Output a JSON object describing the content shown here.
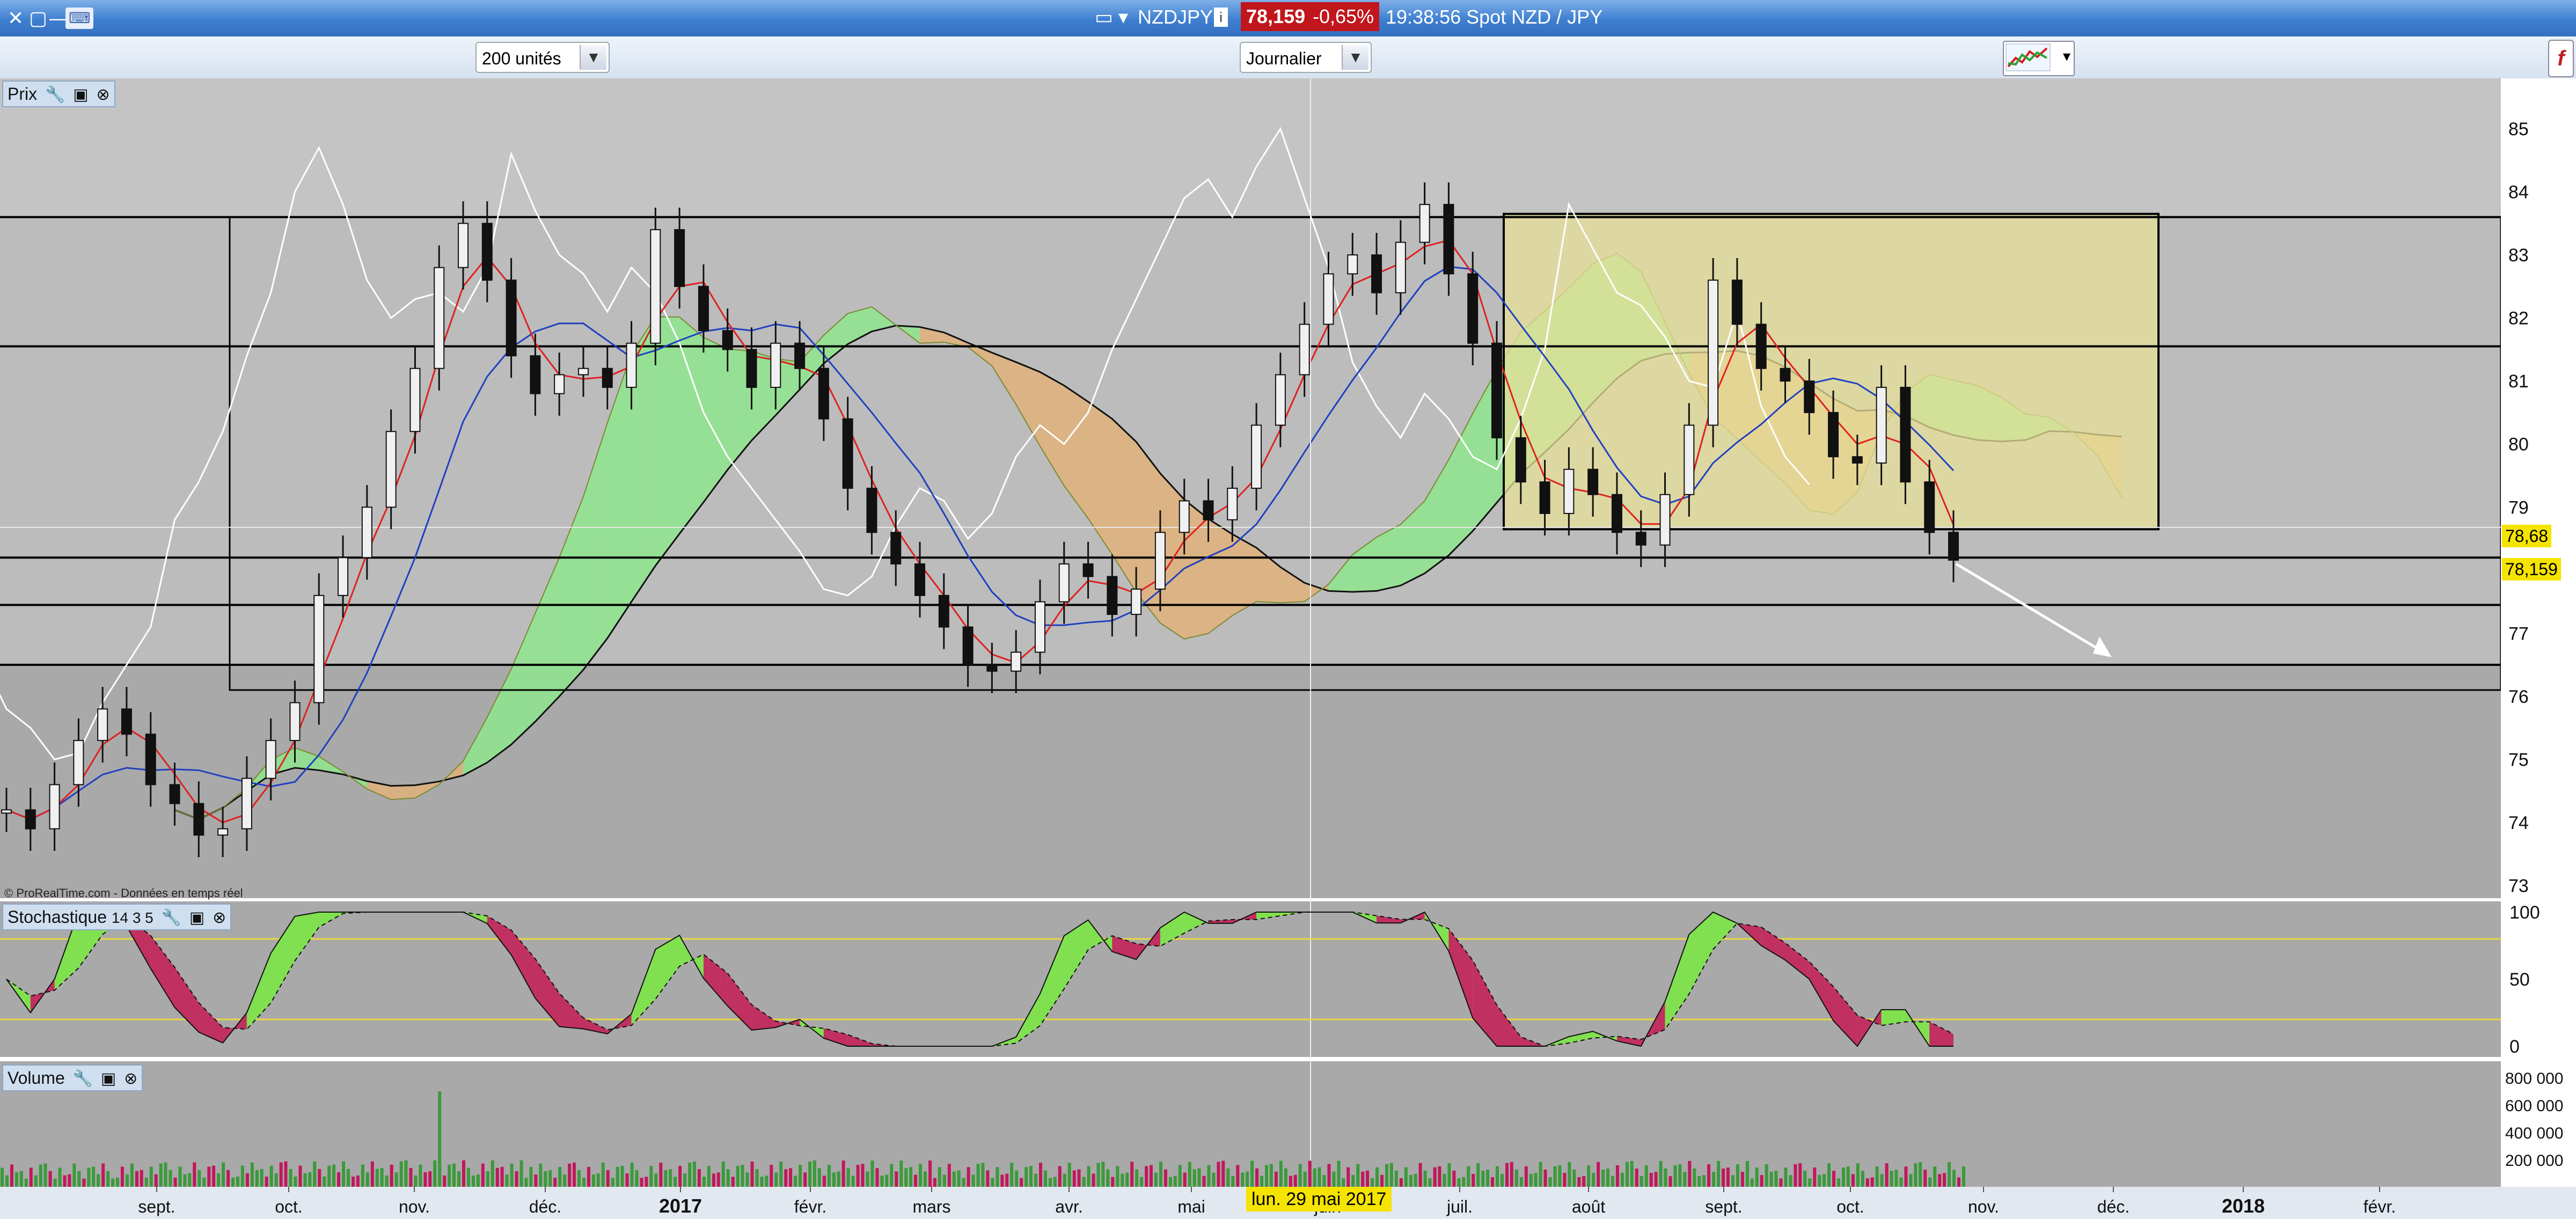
{
  "window": {
    "title": "NZDJPY",
    "price": "78,159",
    "change": "-0,65%",
    "time_text": "19:38:56 Spot NZD / JPY"
  },
  "toolbar": {
    "units_select": "200 unités",
    "period_select": "Journalier"
  },
  "panels": {
    "price_label": "Prix",
    "stoch_label": "Stochastique",
    "stoch_params": "14 3 5",
    "volume_label": "Volume",
    "watermark": "© ProRealTime.com - Données en temps réel"
  },
  "crosshair_date": "lun. 29 mai 2017",
  "colors": {
    "background": "#a9a9a9",
    "tenkan": "#e02020",
    "kijun": "#2040c0",
    "chikou": "#ffffff",
    "cloud_bull": "#8ee68e",
    "cloud_bear": "#e0b27a",
    "highlight_box": "#e8e09a",
    "stoch_bull": "#80e050",
    "stoch_bear": "#c03060",
    "vol_up": "#3a9a3a",
    "vol_down": "#c0185c"
  },
  "chart_data": {
    "type": "candlestick",
    "instrument": "NZDJPY",
    "x_tick_labels": [
      "sept.",
      "oct.",
      "nov.",
      "déc.",
      "2017",
      "févr.",
      "mars",
      "avr.",
      "mai",
      "juin",
      "juil.",
      "août",
      "sept.",
      "oct.",
      "nov.",
      "déc.",
      "2018",
      "févr."
    ],
    "price_axis": {
      "ylim": [
        72.8,
        85.8
      ],
      "ticks": [
        73,
        74,
        75,
        76,
        77,
        78,
        79,
        80,
        81,
        82,
        83,
        84,
        85
      ],
      "current_value_label": "78,159",
      "other_value_label": "78,68"
    },
    "horizontal_lines": [
      83.6,
      81.55,
      78.2,
      77.45,
      76.5
    ],
    "close_series": [
      74.2,
      73.9,
      74.6,
      75.3,
      75.8,
      75.4,
      74.6,
      74.3,
      73.8,
      73.9,
      74.7,
      75.3,
      75.9,
      77.6,
      78.2,
      79.0,
      80.2,
      81.2,
      82.8,
      83.5,
      82.6,
      81.4,
      80.8,
      81.1,
      81.2,
      80.9,
      81.6,
      83.4,
      82.5,
      81.8,
      81.5,
      80.9,
      81.6,
      81.2,
      80.4,
      79.3,
      78.6,
      78.1,
      77.6,
      77.1,
      76.5,
      76.4,
      76.7,
      77.5,
      78.1,
      77.9,
      77.3,
      77.7,
      78.6,
      79.1,
      78.8,
      79.3,
      80.3,
      81.1,
      81.9,
      82.7,
      83.0,
      82.4,
      83.2,
      83.8,
      82.7,
      81.6,
      80.1,
      79.4,
      78.9,
      79.6,
      79.2,
      78.6,
      78.4,
      79.2,
      80.3,
      82.6,
      81.9,
      81.2,
      81.0,
      80.5,
      79.8,
      79.7,
      80.9,
      79.4,
      78.6,
      78.16
    ],
    "stochastic": {
      "ylim": [
        0,
        100
      ],
      "ticks": [
        0,
        50,
        100
      ],
      "levels": [
        80,
        20
      ]
    },
    "volume": {
      "ticks": [
        "200 000",
        "400 000",
        "600 000",
        "800 000"
      ],
      "max": 800000
    },
    "projection_arrow": "down"
  }
}
